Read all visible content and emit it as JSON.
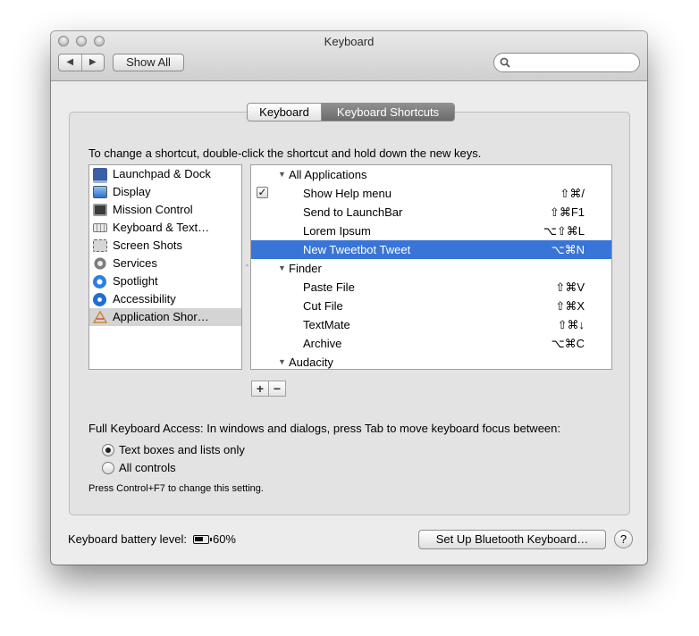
{
  "window": {
    "title": "Keyboard"
  },
  "toolbar": {
    "back_glyph": "◀",
    "forward_glyph": "▶",
    "show_all_label": "Show All",
    "search_value": "",
    "search_icon": "search-icon"
  },
  "tabs": [
    {
      "label": "Keyboard",
      "selected": false
    },
    {
      "label": "Keyboard Shortcuts",
      "selected": true
    }
  ],
  "instructions": "To change a shortcut, double-click the shortcut and hold down the new keys.",
  "sidebar": {
    "items": [
      {
        "label": "Launchpad & Dock",
        "icon": "launchpad-dock-icon",
        "color": "#3a5fa8",
        "selected": false
      },
      {
        "label": "Display",
        "icon": "display-icon",
        "color": "#4a8fd8",
        "selected": false
      },
      {
        "label": "Mission Control",
        "icon": "mission-control-icon",
        "color": "#3b3b3b",
        "selected": false
      },
      {
        "label": "Keyboard & Text…",
        "icon": "keyboard-icon",
        "color": "#bfbfbf",
        "selected": false
      },
      {
        "label": "Screen Shots",
        "icon": "screenshot-icon",
        "color": "#8a8a8a",
        "selected": false
      },
      {
        "label": "Services",
        "icon": "gear-icon",
        "color": "#7d7d7d",
        "selected": false
      },
      {
        "label": "Spotlight",
        "icon": "spotlight-icon",
        "color": "#2f7de0",
        "selected": false
      },
      {
        "label": "Accessibility",
        "icon": "accessibility-icon",
        "color": "#1f6fd6",
        "selected": false
      },
      {
        "label": "Application Shor…",
        "icon": "app-shortcuts-icon",
        "color": "#d08a3a",
        "selected": true
      }
    ]
  },
  "shortcuts": {
    "rows": [
      {
        "type": "group",
        "label": "All Applications",
        "shortcut": ""
      },
      {
        "type": "child",
        "label": "Show Help menu",
        "shortcut": "⇧⌘/",
        "checked": true
      },
      {
        "type": "child",
        "label": "Send to LaunchBar",
        "shortcut": "⇧⌘F1"
      },
      {
        "type": "child",
        "label": "Lorem Ipsum",
        "shortcut": "⌥⇧⌘L"
      },
      {
        "type": "child",
        "label": "New Tweetbot Tweet",
        "shortcut": "⌥⌘N",
        "selected": true
      },
      {
        "type": "group",
        "label": "Finder",
        "shortcut": ""
      },
      {
        "type": "child",
        "label": "Paste File",
        "shortcut": "⇧⌘V"
      },
      {
        "type": "child",
        "label": "Cut File",
        "shortcut": "⇧⌘X"
      },
      {
        "type": "child",
        "label": "TextMate",
        "shortcut": "⇧⌘↓"
      },
      {
        "type": "child",
        "label": "Archive",
        "shortcut": "⌥⌘C"
      },
      {
        "type": "group",
        "label": "Audacity",
        "shortcut": ""
      }
    ],
    "add_label": "+",
    "remove_label": "−"
  },
  "full_keyboard_access": {
    "label": "Full Keyboard Access: In windows and dialogs, press Tab to move keyboard focus between:",
    "options": [
      {
        "label": "Text boxes and lists only",
        "selected": true
      },
      {
        "label": "All controls",
        "selected": false
      }
    ],
    "note": "Press Control+F7 to change this setting."
  },
  "footer": {
    "battery_label": "Keyboard battery level:",
    "battery_value": "60%",
    "battery_icon": "battery-icon",
    "bluetooth_button": "Set Up Bluetooth Keyboard…",
    "help_label": "?"
  },
  "colors": {
    "selection": "#3875d7",
    "tab_selected": "#7a7a7a"
  }
}
